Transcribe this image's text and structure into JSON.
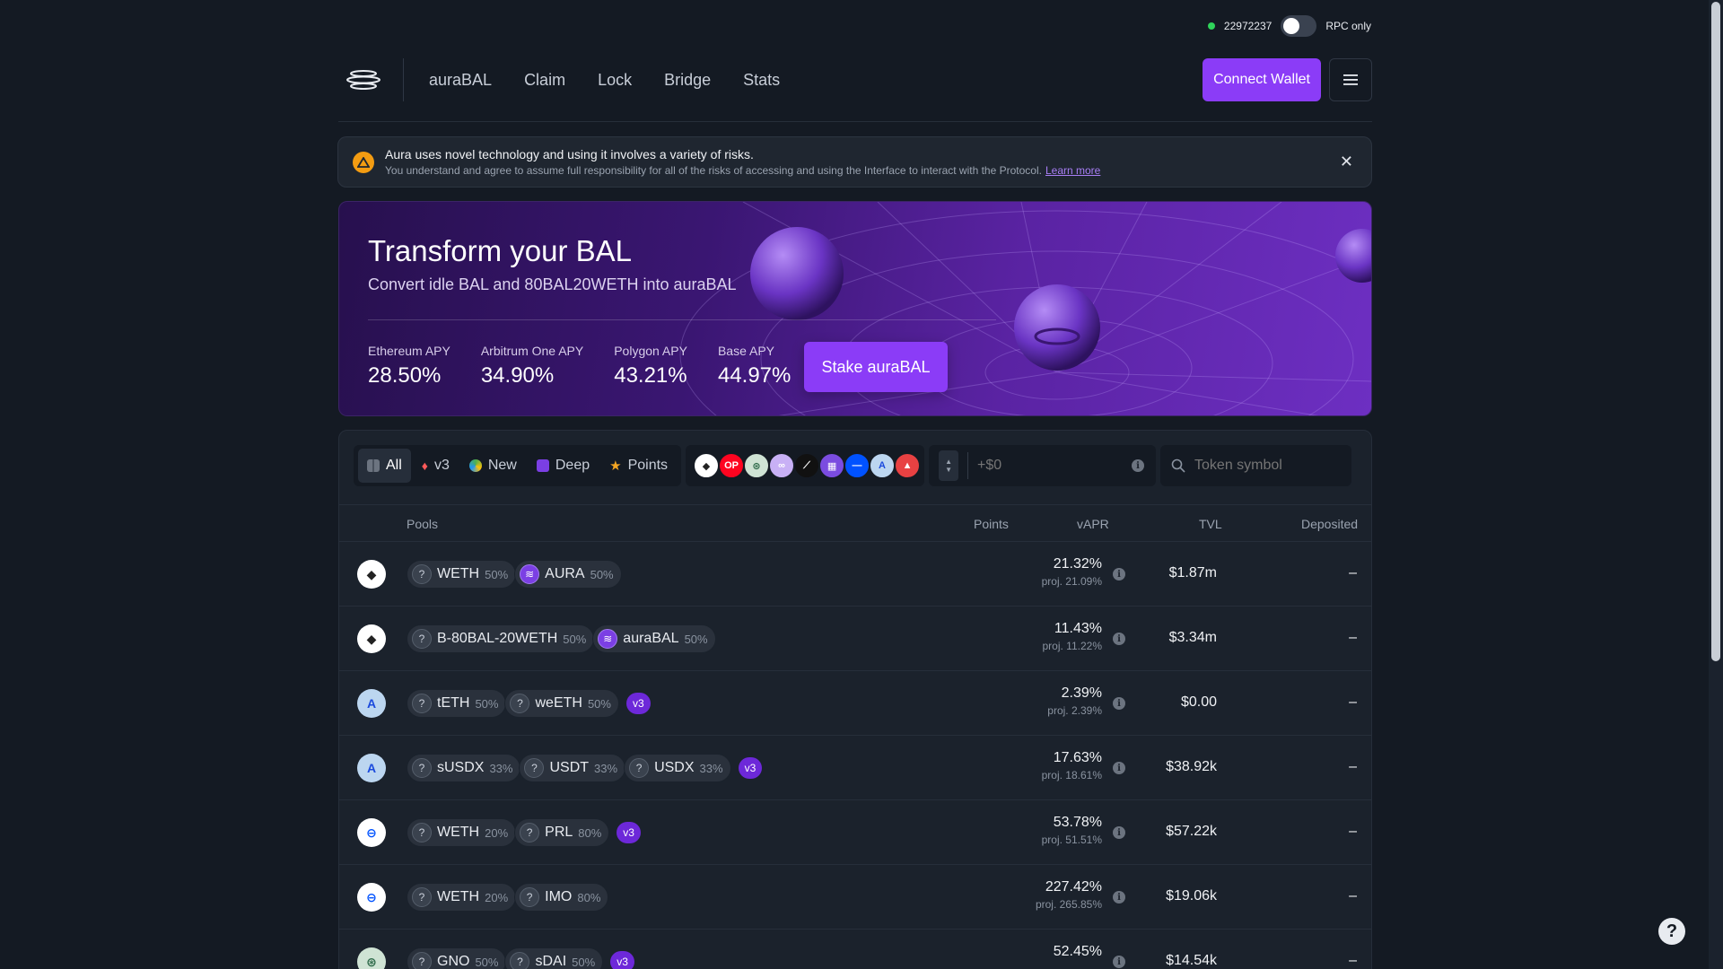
{
  "status": {
    "block_number": "22972237",
    "rpc_label": "RPC only"
  },
  "nav": {
    "items": [
      "auraBAL",
      "Claim",
      "Lock",
      "Bridge",
      "Stats"
    ],
    "connect_label": "Connect Wallet"
  },
  "alert": {
    "title": "Aura uses novel technology and using it involves a variety of risks.",
    "subtitle": "You understand and agree to assume full responsibility for all of the risks of accessing and using the Interface to interact with the Protocol.",
    "link": "Learn more"
  },
  "hero": {
    "title": "Transform your BAL",
    "subtitle": "Convert idle BAL and 80BAL20WETH into auraBAL",
    "apys": [
      {
        "label": "Ethereum APY",
        "value": "28.50%"
      },
      {
        "label": "Arbitrum One APY",
        "value": "34.90%"
      },
      {
        "label": "Polygon APY",
        "value": "43.21%"
      },
      {
        "label": "Base APY",
        "value": "44.97%"
      }
    ],
    "cta": "Stake auraBAL"
  },
  "filters": {
    "tabs": [
      "All",
      "v3",
      "New",
      "Deep",
      "Points"
    ],
    "amount_placeholder": "+$0",
    "search_placeholder": "Token symbol",
    "chains": [
      {
        "name": "ethereum-icon",
        "bg": "#ffffff",
        "fg": "#222222",
        "glyph": "◆"
      },
      {
        "name": "optimism-icon",
        "bg": "#ff0420",
        "fg": "#ffffff",
        "glyph": "OP"
      },
      {
        "name": "gnosis-icon",
        "bg": "#cfe3d4",
        "fg": "#2f6b4b",
        "glyph": "⊛"
      },
      {
        "name": "polygon-icon",
        "bg": "#c8b0f5",
        "fg": "#ffffff",
        "glyph": "∞"
      },
      {
        "name": "zkevm-icon",
        "bg": "#111111",
        "fg": "#ffffff",
        "glyph": "⟋"
      },
      {
        "name": "mode-icon",
        "bg": "#7b4ce0",
        "fg": "#ffffff",
        "glyph": "▦"
      },
      {
        "name": "base-icon",
        "bg": "#0052ff",
        "fg": "#ffffff",
        "glyph": "—"
      },
      {
        "name": "arbitrum-icon",
        "bg": "#bcd6f0",
        "fg": "#1b4add",
        "glyph": "A"
      },
      {
        "name": "avalanche-icon",
        "bg": "#e84142",
        "fg": "#ffffff",
        "glyph": "▲"
      }
    ]
  },
  "table": {
    "headers": {
      "pools": "Pools",
      "points": "Points",
      "vapr": "vAPR",
      "tvl": "TVL",
      "deposited": "Deposited"
    },
    "rows": [
      {
        "network": "ethereum",
        "tokens": [
          {
            "sym": "WETH",
            "w": "50%"
          },
          {
            "sym": "AURA",
            "w": "50%"
          }
        ],
        "v3": false,
        "apr": "21.32%",
        "proj": "proj. 21.09%",
        "tvl": "$1.87m",
        "dep": "–"
      },
      {
        "network": "ethereum",
        "tokens": [
          {
            "sym": "B-80BAL-20WETH",
            "w": "50%"
          },
          {
            "sym": "auraBAL",
            "w": "50%"
          }
        ],
        "v3": false,
        "apr": "11.43%",
        "proj": "proj. 11.22%",
        "tvl": "$3.34m",
        "dep": "–"
      },
      {
        "network": "arbitrum",
        "tokens": [
          {
            "sym": "tETH",
            "w": "50%"
          },
          {
            "sym": "weETH",
            "w": "50%"
          }
        ],
        "v3": true,
        "apr": "2.39%",
        "proj": "proj. 2.39%",
        "tvl": "$0.00",
        "dep": "–"
      },
      {
        "network": "arbitrum",
        "tokens": [
          {
            "sym": "sUSDX",
            "w": "33%"
          },
          {
            "sym": "USDT",
            "w": "33%"
          },
          {
            "sym": "USDX",
            "w": "33%"
          }
        ],
        "v3": true,
        "apr": "17.63%",
        "proj": "proj. 18.61%",
        "tvl": "$38.92k",
        "dep": "–"
      },
      {
        "network": "base",
        "tokens": [
          {
            "sym": "WETH",
            "w": "20%"
          },
          {
            "sym": "PRL",
            "w": "80%"
          }
        ],
        "v3": true,
        "apr": "53.78%",
        "proj": "proj. 51.51%",
        "tvl": "$57.22k",
        "dep": "–"
      },
      {
        "network": "base",
        "tokens": [
          {
            "sym": "WETH",
            "w": "20%"
          },
          {
            "sym": "IMO",
            "w": "80%"
          }
        ],
        "v3": false,
        "apr": "227.42%",
        "proj": "proj. 265.85%",
        "tvl": "$19.06k",
        "dep": "–"
      },
      {
        "network": "gnosis",
        "tokens": [
          {
            "sym": "GNO",
            "w": "50%"
          },
          {
            "sym": "sDAI",
            "w": "50%"
          }
        ],
        "v3": true,
        "apr": "52.45%",
        "proj": "",
        "tvl": "$14.54k",
        "dep": "–"
      }
    ],
    "v3_label": "v3"
  },
  "help_glyph": "?"
}
